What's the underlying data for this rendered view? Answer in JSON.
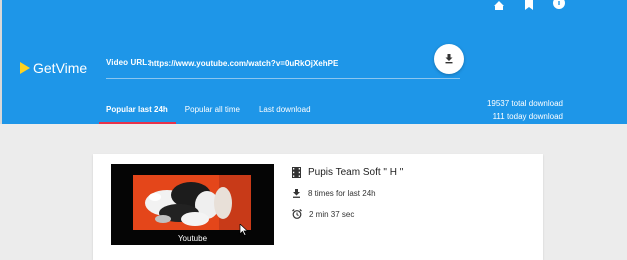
{
  "app": {
    "name": "GetVime"
  },
  "colors": {
    "header": "#1e96e8",
    "accent": "#e8324a",
    "logo": "#ffd21f"
  },
  "top_icons": [
    "home-icon",
    "bookmark-icon",
    "info-icon"
  ],
  "url_bar": {
    "label": "Video URL:",
    "value": "https://www.youtube.com/watch?v=0uRkOjXehPE",
    "button_icon": "download-icon"
  },
  "tabs": [
    {
      "label": "Popular last 24h",
      "active": true
    },
    {
      "label": "Popular all time",
      "active": false
    },
    {
      "label": "Last download",
      "active": false
    }
  ],
  "stats": {
    "total": "19537 total download",
    "today": "111 today download"
  },
  "video": {
    "thumbnail_caption": "Youtube",
    "title": "Pupis Team Soft \" H \"",
    "downloads": "8 times for last 24h",
    "duration": "2 min 37 sec",
    "icons": [
      "film-icon",
      "download-icon",
      "alarm-clock-icon"
    ]
  }
}
